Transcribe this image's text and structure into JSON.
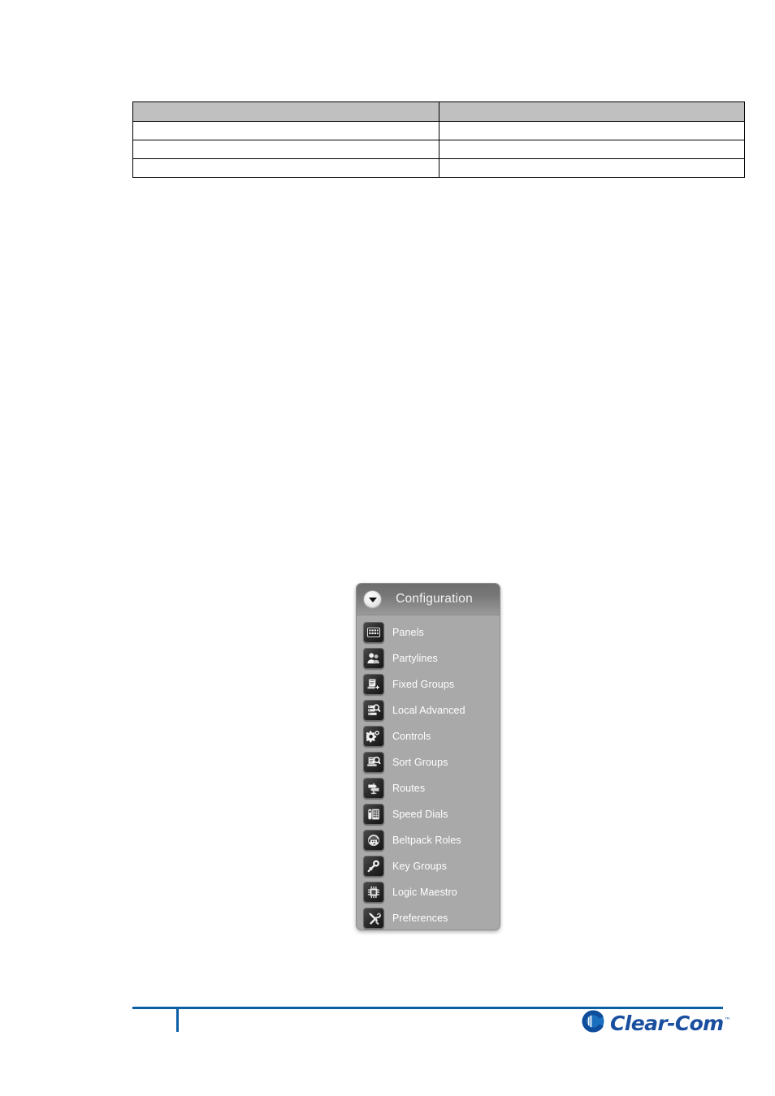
{
  "page": {
    "background_color": "#ffffff"
  },
  "table": {
    "name": "empty-two-column-table",
    "header_fill": "#c0c0c0",
    "border_color": "#000000",
    "columns": [
      "",
      ""
    ],
    "rows": [
      [
        "",
        ""
      ],
      [
        "",
        ""
      ],
      [
        "",
        ""
      ]
    ]
  },
  "config_panel": {
    "title": "Configuration",
    "collapse_icon": "caret-down-icon",
    "background_color": "#a9a9a9",
    "header_text_color": "#f2f2f2",
    "label_color": "#ffffff",
    "items": [
      {
        "label": "Panels",
        "icon": "panel-keys-icon"
      },
      {
        "label": "Partylines",
        "icon": "people-group-icon"
      },
      {
        "label": "Fixed Groups",
        "icon": "document-add-icon"
      },
      {
        "label": "Local Advanced",
        "icon": "list-search-icon"
      },
      {
        "label": "Controls",
        "icon": "gear-icon"
      },
      {
        "label": "Sort Groups",
        "icon": "sort-search-icon"
      },
      {
        "label": "Routes",
        "icon": "signpost-icon"
      },
      {
        "label": "Speed Dials",
        "icon": "telephone-icon"
      },
      {
        "label": "Beltpack Roles",
        "icon": "headset-user-icon"
      },
      {
        "label": "Key Groups",
        "icon": "key-icon"
      },
      {
        "label": "Logic Maestro",
        "icon": "microchip-icon"
      },
      {
        "label": "Preferences",
        "icon": "tools-icon"
      }
    ]
  },
  "footer": {
    "rule_color": "#0b5fa5",
    "logo_text": "Clear-Com",
    "logo_trademark": "™",
    "logo_color": "#1a4fa0"
  }
}
